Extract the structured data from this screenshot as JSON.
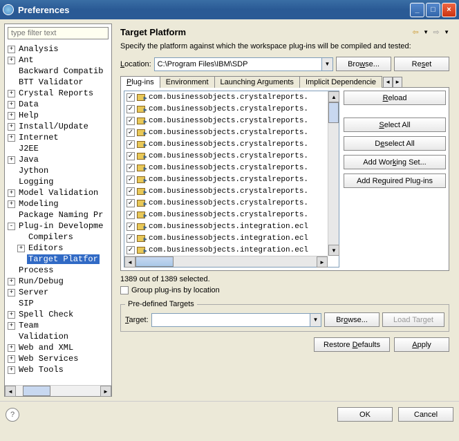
{
  "window": {
    "title": "Preferences"
  },
  "filter_placeholder": "type filter text",
  "tree": {
    "items": [
      {
        "label": "Analysis",
        "expand": "+",
        "indent": 0
      },
      {
        "label": "Ant",
        "expand": "+",
        "indent": 0
      },
      {
        "label": "Backward Compatib",
        "expand": "",
        "indent": 0
      },
      {
        "label": "BTT Validator",
        "expand": "",
        "indent": 0
      },
      {
        "label": "Crystal Reports",
        "expand": "+",
        "indent": 0
      },
      {
        "label": "Data",
        "expand": "+",
        "indent": 0
      },
      {
        "label": "Help",
        "expand": "+",
        "indent": 0
      },
      {
        "label": "Install/Update",
        "expand": "+",
        "indent": 0
      },
      {
        "label": "Internet",
        "expand": "+",
        "indent": 0
      },
      {
        "label": "J2EE",
        "expand": "",
        "indent": 0
      },
      {
        "label": "Java",
        "expand": "+",
        "indent": 0
      },
      {
        "label": "Jython",
        "expand": "",
        "indent": 0
      },
      {
        "label": "Logging",
        "expand": "",
        "indent": 0
      },
      {
        "label": "Model Validation",
        "expand": "+",
        "indent": 0
      },
      {
        "label": "Modeling",
        "expand": "+",
        "indent": 0
      },
      {
        "label": "Package Naming Pr",
        "expand": "",
        "indent": 0
      },
      {
        "label": "Plug-in Developme",
        "expand": "-",
        "indent": 0
      },
      {
        "label": "Compilers",
        "expand": "",
        "indent": 1
      },
      {
        "label": "Editors",
        "expand": "+",
        "indent": 1
      },
      {
        "label": "Target Platfor",
        "expand": "",
        "indent": 1,
        "selected": true
      },
      {
        "label": "Process",
        "expand": "",
        "indent": 0
      },
      {
        "label": "Run/Debug",
        "expand": "+",
        "indent": 0
      },
      {
        "label": "Server",
        "expand": "+",
        "indent": 0
      },
      {
        "label": "SIP",
        "expand": "",
        "indent": 0
      },
      {
        "label": "Spell Check",
        "expand": "+",
        "indent": 0
      },
      {
        "label": "Team",
        "expand": "+",
        "indent": 0
      },
      {
        "label": "Validation",
        "expand": "",
        "indent": 0
      },
      {
        "label": "Web and XML",
        "expand": "+",
        "indent": 0
      },
      {
        "label": "Web Services",
        "expand": "+",
        "indent": 0
      },
      {
        "label": "Web Tools",
        "expand": "+",
        "indent": 0
      }
    ]
  },
  "page": {
    "title": "Target Platform",
    "desc": "Specify the platform against which the workspace plug-ins will be compiled and tested:",
    "location_label": "Location:",
    "location_value": "C:\\Program Files\\IBM\\SDP",
    "browse": "Browse...",
    "reset": "Reset",
    "tabs": [
      "Plug-ins",
      "Environment",
      "Launching Arguments",
      "Implicit Dependencie"
    ],
    "plugins": [
      "com.businessobjects.crystalreports.",
      "com.businessobjects.crystalreports.",
      "com.businessobjects.crystalreports.",
      "com.businessobjects.crystalreports.",
      "com.businessobjects.crystalreports.",
      "com.businessobjects.crystalreports.",
      "com.businessobjects.crystalreports.",
      "com.businessobjects.crystalreports.",
      "com.businessobjects.crystalreports.",
      "com.businessobjects.crystalreports.",
      "com.businessobjects.crystalreports.",
      "com.businessobjects.integration.ecl",
      "com.businessobjects.integration.ecl",
      "com.businessobjects.integration.ecl"
    ],
    "side_buttons": {
      "reload": "Reload",
      "select_all": "Select All",
      "deselect_all": "Deselect All",
      "add_working_set": "Add Working Set...",
      "add_required": "Add Required Plug-ins"
    },
    "status": "1389 out of 1389 selected.",
    "group_check": "Group plug-ins by location",
    "predefined_legend": "Pre-defined Targets",
    "target_label": "Target:",
    "load_target": "Load Target",
    "restore_defaults": "Restore Defaults",
    "apply": "Apply"
  },
  "footer": {
    "ok": "OK",
    "cancel": "Cancel"
  }
}
